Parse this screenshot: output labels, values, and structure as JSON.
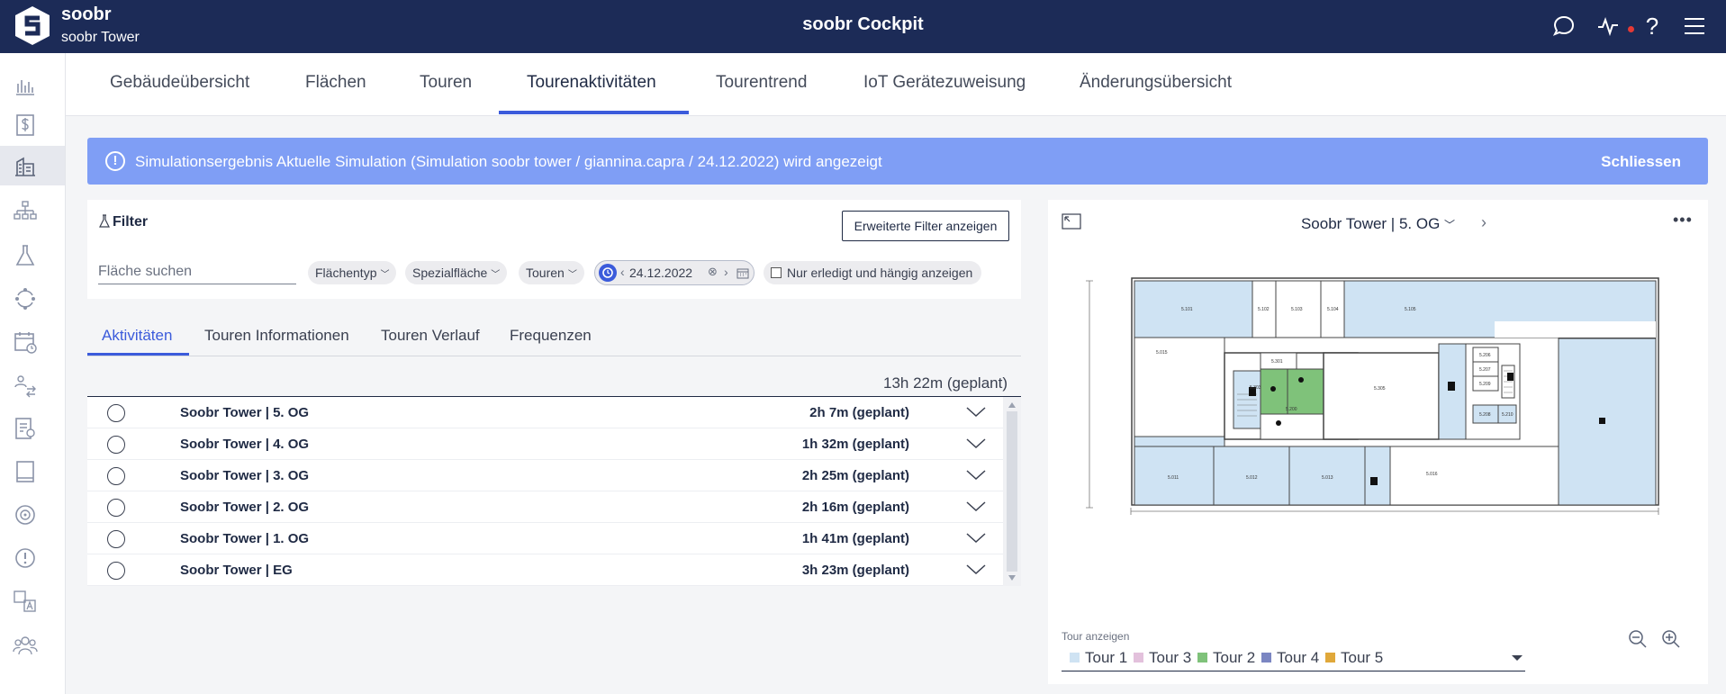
{
  "header": {
    "brand_name": "soobr",
    "brand_sub": "soobr Tower",
    "app_title": "soobr Cockpit",
    "icons": [
      "chat-icon",
      "activity-icon",
      "help-icon",
      "menu-icon"
    ],
    "notification_color": "#e53935"
  },
  "sidebar": {
    "items": [
      "bar-chart-icon",
      "dollar-icon",
      "building-icon",
      "hierarchy-icon",
      "flask-icon",
      "cycle-icon",
      "calendar-clock-icon",
      "user-swap-icon",
      "report-icon",
      "book-icon",
      "target-icon",
      "alert-icon",
      "translate-icon",
      "team-icon"
    ],
    "active_index": 2
  },
  "main_tabs": [
    {
      "label": "Gebäudeübersicht"
    },
    {
      "label": "Flächen"
    },
    {
      "label": "Touren"
    },
    {
      "label": "Tourenaktivitäten",
      "active": true
    },
    {
      "label": "Tourentrend"
    },
    {
      "label": "IoT Gerätezuweisung"
    },
    {
      "label": "Änderungsübersicht"
    }
  ],
  "banner": {
    "icon": "!",
    "text": "Simulationsergebnis Aktuelle Simulation (Simulation soobr tower / giannina.capra / 24.12.2022) wird angezeigt",
    "close_label": "Schliessen",
    "color": "#7f9ef5"
  },
  "filter": {
    "title": "Filter",
    "extended_button": "Erweiterte Filter anzeigen",
    "search_placeholder": "Fläche suchen",
    "chips": [
      "Flächentyp",
      "Spezialfläche",
      "Touren"
    ],
    "date": "24.12.2022",
    "checkbox_label": "Nur erledigt und hängig anzeigen"
  },
  "sub_tabs": [
    {
      "label": "Aktivitäten",
      "active": true
    },
    {
      "label": "Touren Informationen"
    },
    {
      "label": "Touren Verlauf"
    },
    {
      "label": "Frequenzen"
    }
  ],
  "activities": {
    "total": "13h 22m (geplant)",
    "rows": [
      {
        "name": "Soobr Tower | 5. OG",
        "time": "2h 7m (geplant)"
      },
      {
        "name": "Soobr Tower | 4. OG",
        "time": "1h 32m (geplant)"
      },
      {
        "name": "Soobr Tower | 3. OG",
        "time": "2h 25m (geplant)"
      },
      {
        "name": "Soobr Tower | 2. OG",
        "time": "2h 16m (geplant)"
      },
      {
        "name": "Soobr Tower | 1. OG",
        "time": "1h 41m (geplant)"
      },
      {
        "name": "Soobr Tower | EG",
        "time": "3h 23m (geplant)"
      }
    ]
  },
  "plan": {
    "title": "Soobr Tower | 5. OG",
    "tour_label": "Tour anzeigen",
    "tours": [
      {
        "name": "Tour 1",
        "color": "#cfe3f3"
      },
      {
        "name": "Tour 3",
        "color": "#e3c1dc"
      },
      {
        "name": "Tour 2",
        "color": "#7fc27a"
      },
      {
        "name": "Tour 4",
        "color": "#7b86c2"
      },
      {
        "name": "Tour 5",
        "color": "#e0a83a"
      }
    ],
    "rooms": [
      "5.101",
      "5.102",
      "5.103",
      "5.104",
      "5.105",
      "5.015",
      "5.301",
      "5.303",
      "5.305",
      "5.206",
      "5.207",
      "5.209",
      "5.208",
      "5.210",
      "5.200",
      "5.011",
      "5.012",
      "5.013",
      "5.016"
    ]
  }
}
